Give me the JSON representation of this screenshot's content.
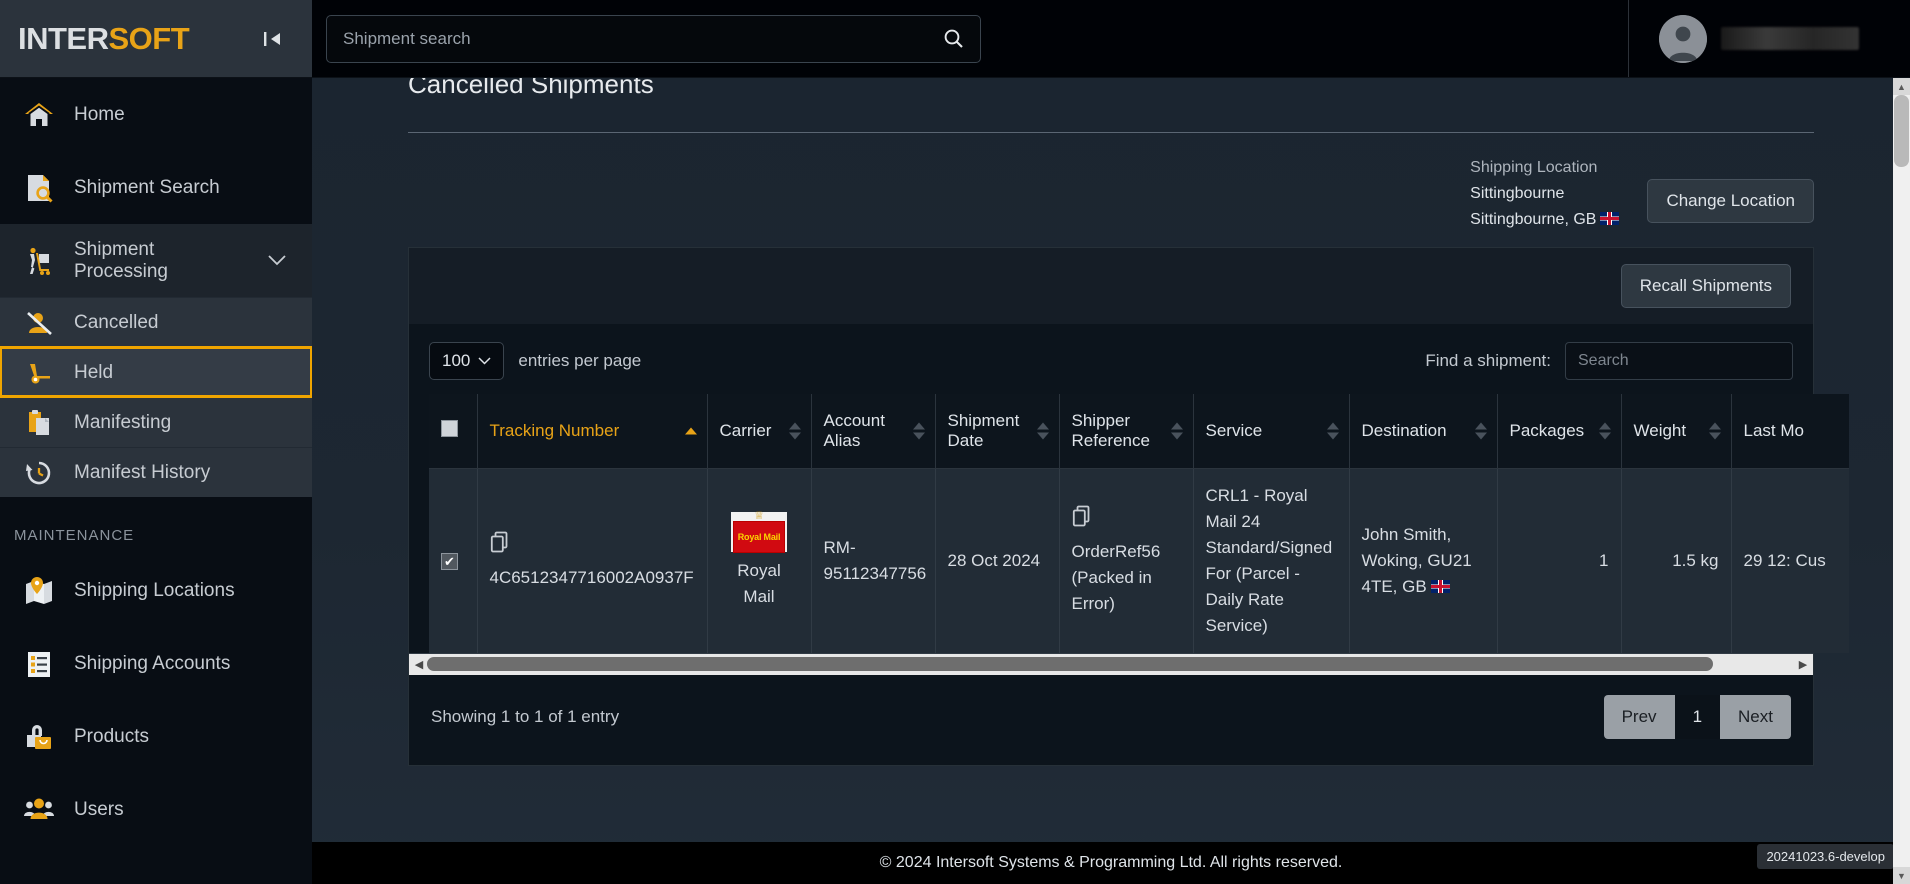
{
  "brand": {
    "name_light": "INTER",
    "name_accent": "SOFT",
    "accent_color": "#e8a317"
  },
  "topbar": {
    "collapse_icon": "collapse-left-icon",
    "search_placeholder": "Shipment search",
    "search_value": "",
    "search_icon": "search-icon",
    "user_name": ""
  },
  "sidebar": {
    "items": [
      {
        "label": "Home",
        "icon": "home-icon"
      },
      {
        "label": "Shipment Search",
        "icon": "document-search-icon"
      },
      {
        "label": "Shipment Processing",
        "icon": "hand-truck-icon",
        "chevron": "⌄"
      }
    ],
    "subitems": [
      {
        "label": "Cancelled",
        "icon": "cancelled-user-icon",
        "active": false
      },
      {
        "label": "Held",
        "icon": "held-trolley-icon",
        "active": true
      },
      {
        "label": "Manifesting",
        "icon": "manifest-clipboard-icon",
        "active": false
      },
      {
        "label": "Manifest History",
        "icon": "history-clock-icon",
        "active": false
      }
    ],
    "section_label": "MAINTENANCE",
    "maintenance": [
      {
        "label": "Shipping Locations",
        "icon": "map-pin-icon"
      },
      {
        "label": "Shipping Accounts",
        "icon": "list-document-icon"
      },
      {
        "label": "Products",
        "icon": "shopping-bag-icon"
      },
      {
        "label": "Users",
        "icon": "users-icon"
      }
    ]
  },
  "main": {
    "page_title": "Cancelled Shipments",
    "location": {
      "label": "Shipping Location",
      "name": "Sittingbourne",
      "address": "Sittingbourne, GB",
      "flag": "gb-flag-icon",
      "change_button": "Change Location"
    },
    "recall_button": "Recall Shipments",
    "controls": {
      "page_length": "100",
      "page_length_suffix": "entries per page",
      "find_label": "Find a shipment:",
      "find_placeholder": "Search",
      "find_value": ""
    },
    "table": {
      "columns": [
        {
          "label": "",
          "name": "select-all",
          "sortable": false
        },
        {
          "label": "Tracking Number",
          "name": "tracking-number",
          "sortable": true,
          "sorted": "asc"
        },
        {
          "label": "Carrier",
          "name": "carrier",
          "sortable": true
        },
        {
          "label": "Account Alias",
          "name": "account-alias",
          "sortable": true
        },
        {
          "label": "Shipment Date",
          "name": "shipment-date",
          "sortable": true
        },
        {
          "label": "Shipper Reference",
          "name": "shipper-reference",
          "sortable": true
        },
        {
          "label": "Service",
          "name": "service",
          "sortable": true
        },
        {
          "label": "Destination",
          "name": "destination",
          "sortable": true
        },
        {
          "label": "Packages",
          "name": "packages",
          "sortable": true
        },
        {
          "label": "Weight",
          "name": "weight",
          "sortable": true
        },
        {
          "label": "Last Mo",
          "name": "last-modified",
          "sortable": true
        }
      ],
      "rows": [
        {
          "selected": true,
          "tracking_number": "4C6512347716002A0937F",
          "carrier": "Royal Mail",
          "carrier_logo_text": "Royal Mail",
          "account_alias": "RM-95112347756",
          "shipment_date": "28 Oct 2024",
          "shipper_reference": "OrderRef56 (Packed in Error)",
          "service": "CRL1 - Royal Mail 24 Standard/Signed For (Parcel - Daily Rate Service)",
          "destination": "John Smith, Woking, GU21 4TE, GB",
          "packages": "1",
          "weight": "1.5 kg",
          "last_modified": "29 12: Cus"
        }
      ]
    },
    "showing_text": "Showing 1 to 1 of 1 entry",
    "pager": {
      "prev": "Prev",
      "current": "1",
      "next": "Next"
    }
  },
  "footer": {
    "copyright": "© 2024 Intersoft Systems & Programming Ltd. All rights reserved.",
    "version": "20241023.6-develop"
  }
}
